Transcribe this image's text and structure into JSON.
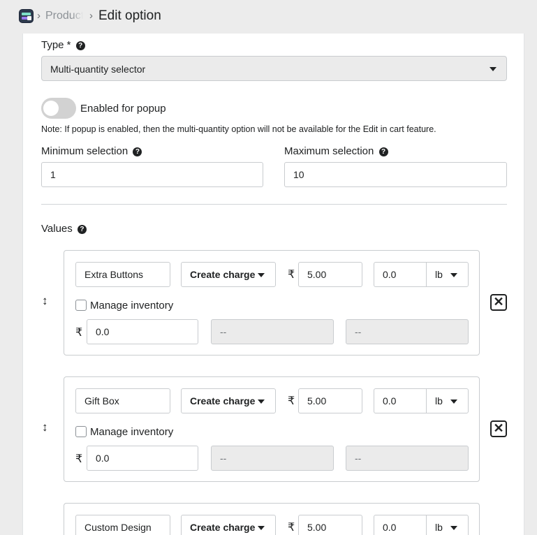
{
  "breadcrumb": {
    "parent": "Product",
    "current": "Edit option"
  },
  "type_field": {
    "label": "Type *",
    "selected": "Multi-quantity selector"
  },
  "popup_toggle": {
    "label": "Enabled for popup",
    "enabled": false
  },
  "note": "Note: If popup is enabled, then the multi-quantity option will not be available for the Edit in cart feature.",
  "min_selection": {
    "label": "Minimum selection",
    "value": "1"
  },
  "max_selection": {
    "label": "Maximum selection",
    "value": "10"
  },
  "values_label": "Values",
  "values": [
    {
      "name": "Extra Buttons",
      "charge_label": "Create charge",
      "currency": "₹",
      "price": "5.00",
      "weight": "0.0",
      "unit": "lb",
      "manage_inventory_label": "Manage inventory",
      "inv_currency": "₹",
      "inv_value": "0.0",
      "field2": "--",
      "field3": "--"
    },
    {
      "name": "Gift Box",
      "charge_label": "Create charge",
      "currency": "₹",
      "price": "5.00",
      "weight": "0.0",
      "unit": "lb",
      "manage_inventory_label": "Manage inventory",
      "inv_currency": "₹",
      "inv_value": "0.0",
      "field2": "--",
      "field3": "--"
    },
    {
      "name": "Custom Design",
      "charge_label": "Create charge",
      "currency": "₹",
      "price": "5.00",
      "weight": "0.0",
      "unit": "lb"
    }
  ],
  "icons": {
    "help": "?",
    "drag": "↕",
    "remove": "✕"
  }
}
